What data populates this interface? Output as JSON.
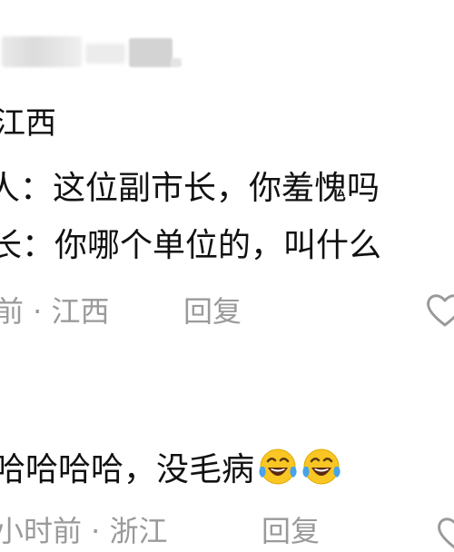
{
  "comment1": {
    "region_label": "江西",
    "line1": "人：这位副市长，你羞愧吗",
    "line2": "长：你哪个单位的，叫什么",
    "meta": "前 · 江西",
    "reply_label": "回复"
  },
  "comment2": {
    "text": "哈哈哈哈，没毛病",
    "emoji_names": [
      "laughing-tears-icon",
      "laughing-tears-icon"
    ],
    "meta": "小时前 · 浙江",
    "reply_label": "回复"
  },
  "colors": {
    "text": "#111111",
    "meta": "#9a9a9a",
    "emoji_face": "#f9c623",
    "tears": "#4aa3e8"
  }
}
